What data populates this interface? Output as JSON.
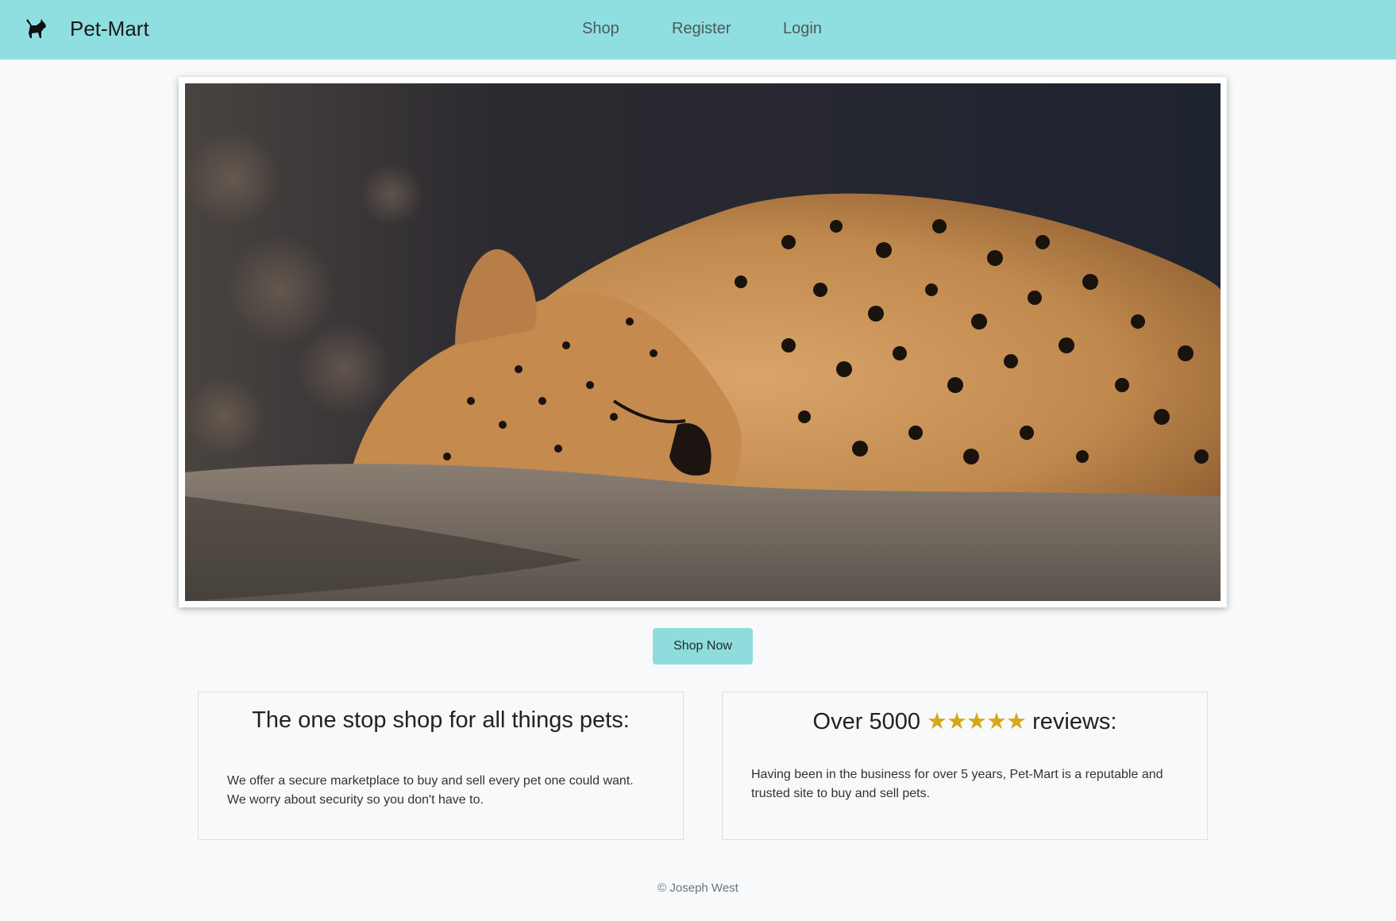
{
  "navbar": {
    "brand": "Pet-Mart",
    "brand_icon": "dog-icon",
    "links": [
      "Shop",
      "Register",
      "Login"
    ],
    "background": "#90dfe0"
  },
  "hero": {
    "image": "sleeping-cheetah-photo"
  },
  "cta": {
    "label": "Shop Now",
    "color": "#8fdcdd"
  },
  "cards": [
    {
      "title": "The one stop shop for all things pets:",
      "body": "We offer a secure marketplace to buy and sell every pet one could want. We worry about security so you don't have to."
    },
    {
      "title_prefix": "Over 5000",
      "stars": "★★★★★",
      "title_suffix": "reviews:",
      "body": "Having been in the business for over 5 years, Pet-Mart is a reputable and trusted site to buy and sell pets."
    }
  ],
  "footer": {
    "text": "© Joseph West"
  },
  "colors": {
    "star": "#d4a819",
    "page_bg": "#f8f9fa"
  }
}
